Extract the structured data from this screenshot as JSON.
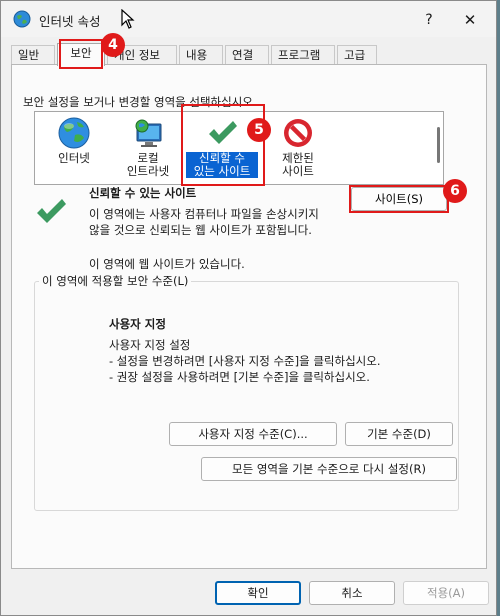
{
  "window": {
    "title": "인터넷 속성",
    "help": "?",
    "close": "✕"
  },
  "tabs": [
    {
      "label": "일반"
    },
    {
      "label": "보안"
    },
    {
      "label": "개인 정보"
    },
    {
      "label": "내용"
    },
    {
      "label": "연결"
    },
    {
      "label": "프로그램"
    },
    {
      "label": "고급"
    }
  ],
  "security": {
    "instruction": "보안 설정을 보거나 변경할 영역을 선택하십시오.",
    "zones": [
      {
        "label": "인터넷",
        "icon": "globe-icon"
      },
      {
        "label": "로컬\n인트라넷",
        "icon": "monitor-globe-icon"
      },
      {
        "label": "신뢰할 수\n있는 사이트",
        "icon": "checkmark-icon"
      },
      {
        "label": "제한된\n사이트",
        "icon": "restricted-icon"
      }
    ],
    "selected_zone": {
      "name": "신뢰할 수 있는 사이트",
      "description": "이 영역에는 사용자 컴퓨터나 파일을 손상시키지\n않을 것으로 신뢰되는 웹 사이트가 포함됩니다.",
      "note": "이 영역에 웹 사이트가 있습니다.",
      "sites_button": "사이트(S)"
    },
    "level_group": {
      "legend": "이 영역에 적용할 보안 수준(L)",
      "title": "사용자 지정",
      "lines": [
        "사용자 지정 설정",
        "- 설정을 변경하려면 [사용자 지정 수준]을 클릭하십시오.",
        "- 권장 설정을 사용하려면 [기본 수준]을 클릭하십시오."
      ],
      "custom_level_button": "사용자 지정 수준(C)...",
      "default_level_button": "기본 수준(D)"
    },
    "reset_all_button": "모든 영역을 기본 수준으로 다시 설정(R)"
  },
  "footer": {
    "ok": "확인",
    "cancel": "취소",
    "apply": "적용(A)"
  },
  "badges": [
    "4",
    "5",
    "6"
  ],
  "colors": {
    "highlight": "#e01a1a",
    "selection": "#0a64d2",
    "accent": "#0063b1"
  }
}
